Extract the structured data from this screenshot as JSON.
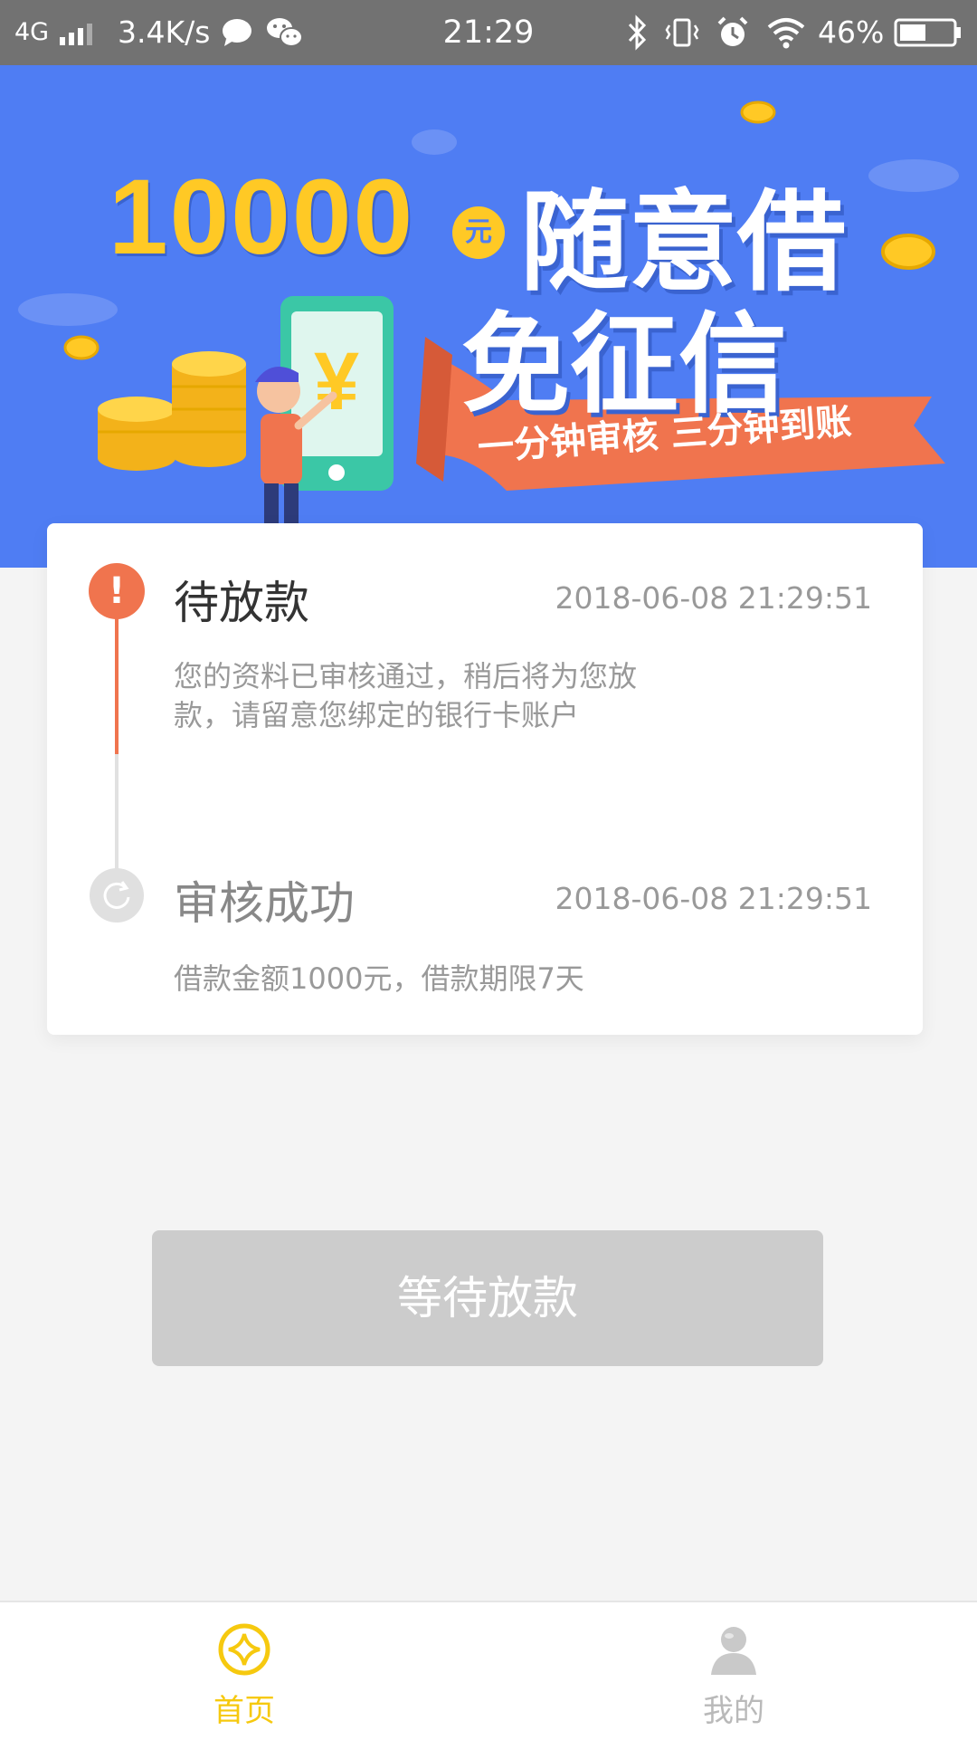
{
  "status_bar": {
    "network": "4G",
    "speed": "3.4K/s",
    "time": "21:29",
    "battery": "46%",
    "icons": [
      "signal-icon",
      "message-icon",
      "wechat-icon",
      "bluetooth-icon",
      "vibrate-icon",
      "alarm-icon",
      "wifi-icon",
      "battery-icon"
    ]
  },
  "banner": {
    "amount": "10000",
    "unit": "元",
    "title_line1": "随意借",
    "title_line2": "免征信",
    "slogan": "一分钟审核 三分钟到账",
    "currency_symbol": "¥",
    "colors": {
      "background": "#4f7df3",
      "accent": "#ffc925",
      "ribbon": "#f0744e"
    }
  },
  "timeline": {
    "steps": [
      {
        "title": "待放款",
        "time": "2018-06-08 21:29:51",
        "desc": "您的资料已审核通过，稍后将为您放款，请留意您绑定的银行卡账户",
        "status": "active",
        "icon": "alert-icon",
        "icon_glyph": "!"
      },
      {
        "title": "审核成功",
        "time": "2018-06-08 21:29:51",
        "desc": "借款金额1000元，借款期限7天",
        "status": "done",
        "icon": "refresh-icon"
      }
    ],
    "colors": {
      "active": "#f0744e",
      "inactive": "#e0e0e0"
    }
  },
  "action_button": {
    "label": "等待放款",
    "enabled": false
  },
  "tabbar": {
    "items": [
      {
        "label": "首页",
        "icon": "home-coin-icon",
        "active": true
      },
      {
        "label": "我的",
        "icon": "user-icon",
        "active": false
      }
    ],
    "colors": {
      "active": "#f6c90f",
      "inactive": "#b9b9b9"
    }
  }
}
